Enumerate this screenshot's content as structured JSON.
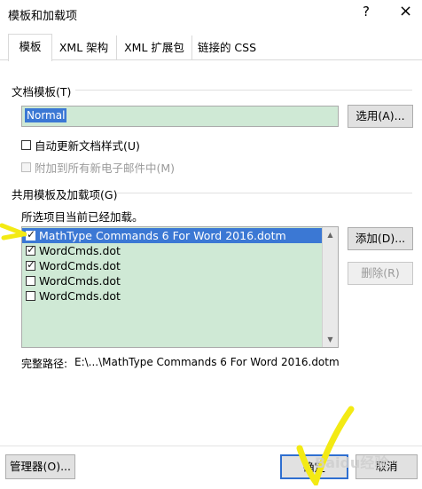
{
  "window": {
    "title": "模板和加载项",
    "help_glyph": "?",
    "close_glyph": "×"
  },
  "tabs": [
    {
      "label": "模板",
      "active": true
    },
    {
      "label": "XML 架构",
      "active": false
    },
    {
      "label": "XML 扩展包",
      "active": false
    },
    {
      "label": "链接的 CSS",
      "active": false
    }
  ],
  "document_template": {
    "group_label": "文档模板(T)",
    "value": "Normal",
    "select_button": "选用(A)...",
    "auto_update_label": "自动更新文档样式(U)",
    "auto_update_checked": false,
    "attach_email_label": "附加到所有新电子邮件中(M)",
    "attach_email_checked": false,
    "attach_email_disabled": true
  },
  "global_templates": {
    "group_label": "共用模板及加载项(G)",
    "note": "所选项目当前已经加载。",
    "items": [
      {
        "label": "MathType Commands 6 For Word 2016.dotm",
        "checked": true,
        "selected": true
      },
      {
        "label": "WordCmds.dot",
        "checked": true,
        "selected": false
      },
      {
        "label": "WordCmds.dot",
        "checked": true,
        "selected": false
      },
      {
        "label": "WordCmds.dot",
        "checked": false,
        "selected": false
      },
      {
        "label": "WordCmds.dot",
        "checked": false,
        "selected": false
      }
    ],
    "add_button": "添加(D)...",
    "remove_button": "删除(R)",
    "remove_disabled": true,
    "full_path_label": "完整路径:",
    "full_path_value": "E:\\...\\MathType Commands 6 For Word 2016.dotm"
  },
  "footer": {
    "organizer_button": "管理器(O)...",
    "ok_button": "确定",
    "cancel_button": "取消"
  },
  "overlay": {
    "watermark": "Baidu经验",
    "accent_color": "#f3ea14"
  }
}
